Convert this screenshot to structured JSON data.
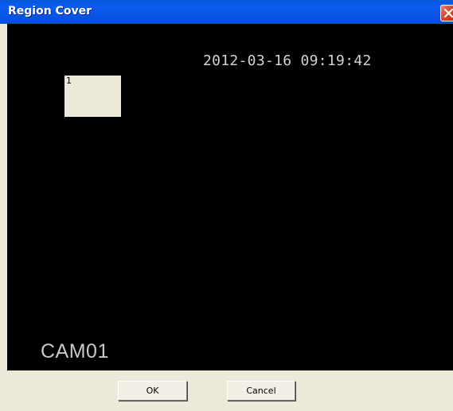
{
  "window": {
    "title": "Region Cover",
    "close_icon": "close-icon"
  },
  "video": {
    "timestamp": "2012-03-16 09:19:42",
    "camera_label": "CAM01",
    "regions": [
      {
        "label": "1"
      }
    ]
  },
  "buttons": {
    "ok_label": "OK",
    "cancel_label": "Cancel"
  },
  "colors": {
    "titlebar": "#0a56e6",
    "video_background": "#000000",
    "dialog_background": "#ece9d8",
    "close_button": "#d9452a"
  }
}
